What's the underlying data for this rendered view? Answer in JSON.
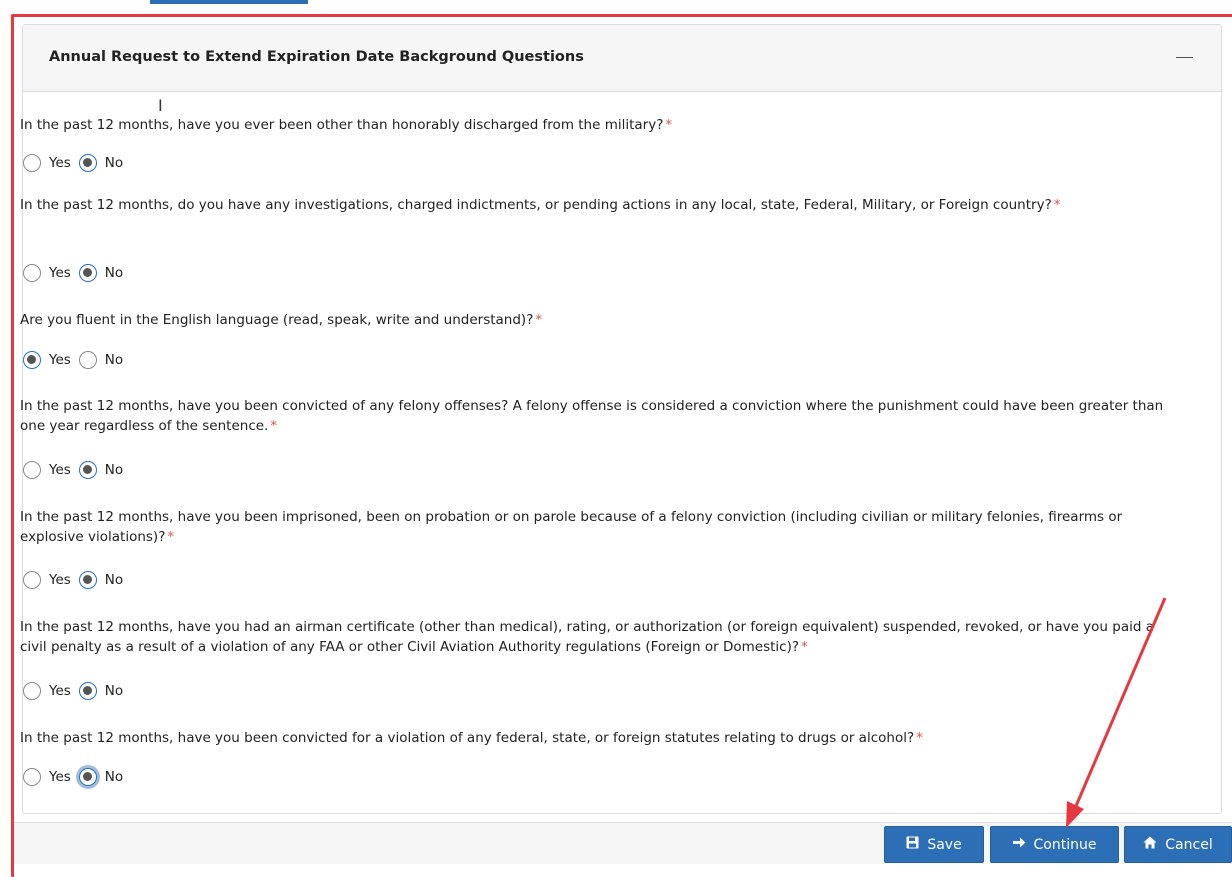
{
  "panel": {
    "title": "Annual Request to Extend Expiration Date Background Questions",
    "collapse_icon": "minus-icon"
  },
  "required_marker": "*",
  "options": {
    "yes": "Yes",
    "no": "No"
  },
  "questions": [
    {
      "text": "In the past 12 months, have you ever been other than honorably discharged from the military?",
      "answer": "No"
    },
    {
      "text": "In the past 12 months, do you have any investigations, charged indictments, or pending actions in any local, state, Federal, Military, or Foreign country?",
      "answer": "No"
    },
    {
      "text": "Are you fluent in the English language (read, speak, write and understand)?",
      "answer": "Yes"
    },
    {
      "text": "In the past 12 months, have you been convicted of any felony offenses? A felony offense is considered a conviction where the punishment could have been greater than one year regardless of the sentence.",
      "answer": "No"
    },
    {
      "text": "In the past 12 months, have you been imprisoned, been on probation or on parole because of a felony conviction (including civilian or military felonies, firearms or explosive violations)?",
      "answer": "No"
    },
    {
      "text": "In the past 12 months, have you had an airman certificate (other than medical), rating, or authorization (or foreign equivalent) suspended, revoked, or have you paid a civil penalty as a result of a violation of any FAA or other Civil Aviation Authority regulations (Foreign or Domestic)?",
      "answer": "No"
    },
    {
      "text": "In the past 12 months, have you been convicted for a violation of any federal, state, or foreign statutes relating to drugs or alcohol?",
      "answer": "No"
    }
  ],
  "buttons": {
    "save": {
      "label": "Save",
      "icon": "floppy-disk-icon"
    },
    "continue": {
      "label": "Continue",
      "icon": "arrow-right-icon"
    },
    "cancel": {
      "label": "Cancel",
      "icon": "home-icon"
    }
  },
  "colors": {
    "primary": "#2c6fb7",
    "annotation": "#e8383f",
    "required": "#d9534f"
  }
}
